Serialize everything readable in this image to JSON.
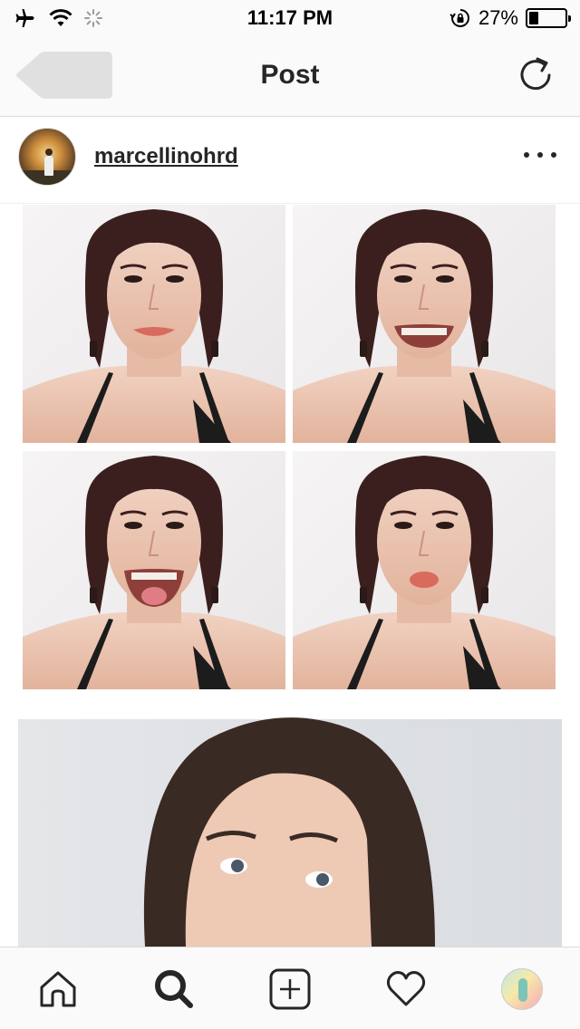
{
  "status_bar": {
    "time": "11:17 PM",
    "battery_percent": "27%",
    "battery_level": 0.27
  },
  "nav": {
    "title": "Post"
  },
  "post": {
    "username": "marcellinohrd"
  },
  "tab_bar": {
    "tabs": [
      {
        "icon": "home-icon"
      },
      {
        "icon": "search-icon"
      },
      {
        "icon": "add-post-icon"
      },
      {
        "icon": "heart-icon"
      },
      {
        "icon": "profile-avatar"
      }
    ]
  },
  "colors": {
    "bar_background": "#fafafa",
    "divider": "#dbdbdb",
    "text": "#262626"
  }
}
